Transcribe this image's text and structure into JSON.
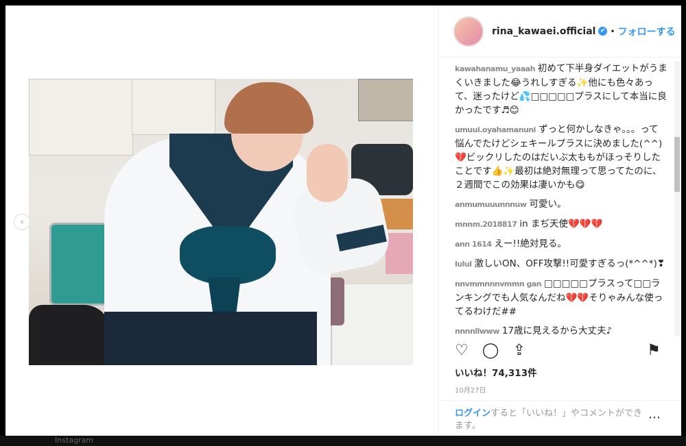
{
  "post": {
    "username": "rina_kawaei.official",
    "verified_glyph": "✔",
    "separator": "•",
    "follow_label": "フォローする",
    "prev_arrow": "‹"
  },
  "comments": [
    {
      "handle": "kawahanamu_yaaah",
      "text": "初めて下半身ダイエットがうまくいきました😂うれしすぎる✨他にも色々あって、迷ったけど💦□□□□□プラスにして本当に良かったです♬😊"
    },
    {
      "handle": "umuui.oyahamanuni",
      "text": "ずっと何かしなきゃ。。。って悩んでたけどシェキールプラスに決めました(^^)💔ビックリしたのはだいぶ太ももがほっそりしたことです👍✨最初は絶対無理って思ってたのに、２週間でこの効果は凄いかも😋"
    },
    {
      "handle": "anmumuuunnnuw",
      "text": "可愛い。"
    },
    {
      "handle": "mnnm.2018817",
      "text": "in まぢ天使💔💔💔"
    },
    {
      "handle": "ann 1614",
      "text": "えー!!絶対見る。"
    },
    {
      "handle": "lulul",
      "text": "激しいON、OFF攻撃!!可愛すぎるっ(*^^*)❣"
    },
    {
      "handle": "nnvmmnnnvmmn gan",
      "text": "□□□□□プラスって□□ランキングでも人気なんだね💔💔そりゃみんな使ってるわけだ##"
    },
    {
      "handle": "nnnnllwww",
      "text": "17歳に見えるから大丈夫♪"
    }
  ],
  "actions": {
    "like_icon": "♡",
    "comment_icon": "◯",
    "share_icon": "⇪",
    "save_icon": "⚑"
  },
  "likes_text": "いいね！74,313件",
  "date_text": "10月27日",
  "footer": {
    "login_link": "ログイン",
    "login_rest": "すると「いいね！」やコメントができます。",
    "more_icon": "⋯"
  },
  "bottom_text": "Instagram"
}
